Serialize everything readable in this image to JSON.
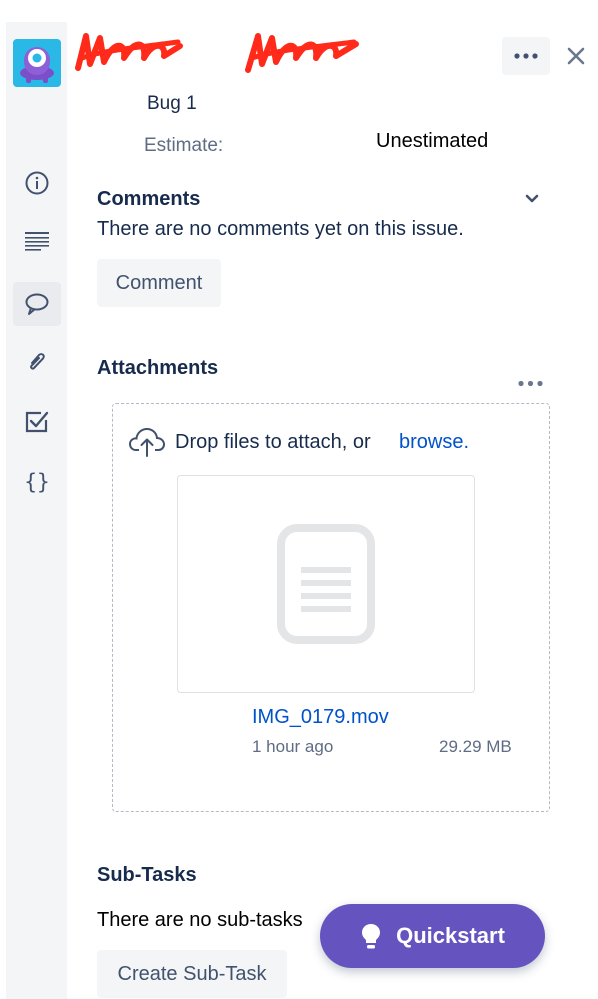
{
  "issue": {
    "summary": "Bug 1",
    "estimate_label": "Estimate:",
    "estimate_value": "Unestimated"
  },
  "comments": {
    "title": "Comments",
    "empty_text": "There are no comments yet on this issue.",
    "button_label": "Comment"
  },
  "attachments": {
    "title": "Attachments",
    "drop_text": "Drop files to attach, or",
    "browse_label": "browse.",
    "file": {
      "name": "IMG_0179.mov",
      "time": "1 hour ago",
      "size": "29.29 MB"
    }
  },
  "subtasks": {
    "title": "Sub-Tasks",
    "empty_text": "There are no sub-tasks",
    "button_label": "Create Sub-Task"
  },
  "quickstart": {
    "label": "Quickstart"
  },
  "colors": {
    "accent": "#6554c0",
    "link": "#0052cc",
    "logo": "#2ab8e6",
    "redaction": "#ff2a1a"
  }
}
